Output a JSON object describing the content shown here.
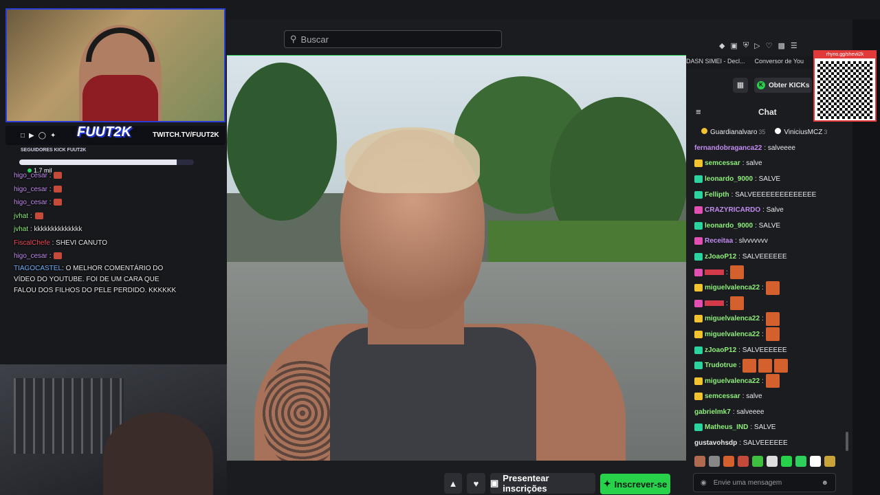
{
  "search": {
    "placeholder": "Buscar"
  },
  "bookmarks": [
    "DASN SIMEI - Decl...",
    "Conversor de You"
  ],
  "stream_overlay": {
    "brand": "FUUT2K",
    "twitch_url": "TWITCH.TV/FUUT2K",
    "followers_label": "SEGUIDORES KICK FUUT2K",
    "followers_count": "1.7 mil",
    "followers_progress": 0.9
  },
  "left_chat": [
    {
      "user": "higo_cesar",
      "text": ":",
      "color": "purple",
      "emote": true
    },
    {
      "user": "higo_cesar",
      "text": ":",
      "color": "purple",
      "emote": true
    },
    {
      "user": "higo_cesar",
      "text": ":",
      "color": "purple",
      "emote": true
    },
    {
      "user": "jvhat",
      "text": ":",
      "color": "green",
      "emote": true
    },
    {
      "user": "jvhat",
      "text": ": kkkkkkkkkkkkkk",
      "color": "green",
      "emote": false
    },
    {
      "user": "FiscalChefe",
      "text": ": SHEVI CANUTO",
      "color": "red",
      "emote": false
    },
    {
      "user": "higo_cesar",
      "text": ":",
      "color": "purple",
      "emote": true
    }
  ],
  "left_chat_long": {
    "user": "TIAGOCASTEL",
    "text": ": O MELHOR COMENTÁRIO DO VÍDEO DO YOUTUBE. FOI DE UM CARA QUE FALOU DOS FILHOS DO PELE PERDIDO. KKKKKK"
  },
  "player_buttons": {
    "gift": "Presentear inscrições",
    "subscribe": "Inscrever-se"
  },
  "chat": {
    "title": "Chat",
    "kicks_label": "Obter KICKs",
    "pinned": [
      {
        "user": "Guardianalvaro",
        "count": "35"
      },
      {
        "user": "ViniciusMCZ",
        "count": "3"
      }
    ],
    "input_placeholder": "Envie uma mensagem",
    "messages": [
      {
        "user": "fernandobraganca22",
        "text": ": salveeee",
        "color": "#c28cf0",
        "badge": "",
        "sticker": 0
      },
      {
        "user": "semcessar",
        "text": ": salve",
        "color": "#8ef07a",
        "badge": "yellow",
        "sticker": 0
      },
      {
        "user": "leonardo_9000",
        "text": ": SALVE",
        "color": "#8ef07a",
        "badge": "teal",
        "sticker": 0
      },
      {
        "user": "Fellipth",
        "text": ": SALVEEEEEEEEEEEEEE",
        "color": "#8ef07a",
        "badge": "teal",
        "sticker": 0
      },
      {
        "user": "CRAZYRICARDO",
        "text": ": Salve",
        "color": "#c28cf0",
        "badge": "pink",
        "sticker": 0
      },
      {
        "user": "leonardo_9000",
        "text": ": SALVE",
        "color": "#8ef07a",
        "badge": "teal",
        "sticker": 0
      },
      {
        "user": "Receitaa",
        "text": ": slvvvvvvv",
        "color": "#c28cf0",
        "badge": "pink",
        "sticker": 0
      },
      {
        "user": "zJoaoP12",
        "text": ": SALVEEEEEE",
        "color": "#8ef07a",
        "badge": "teal",
        "sticker": 0
      },
      {
        "user": "",
        "text": ":",
        "color": "#f14b5a",
        "badge": "pink",
        "sticker": 1
      },
      {
        "user": "miguelvalenca22",
        "text": ":",
        "color": "#8ef07a",
        "badge": "yellow",
        "sticker": 1
      },
      {
        "user": "",
        "text": ":",
        "color": "#f14b5a",
        "badge": "pink",
        "sticker": 1
      },
      {
        "user": "miguelvalenca22",
        "text": ":",
        "color": "#8ef07a",
        "badge": "yellow",
        "sticker": 1
      },
      {
        "user": "miguelvalenca22",
        "text": ":",
        "color": "#8ef07a",
        "badge": "yellow",
        "sticker": 1
      },
      {
        "user": "zJoaoP12",
        "text": ": SALVEEEEEE",
        "color": "#8ef07a",
        "badge": "teal",
        "sticker": 0
      },
      {
        "user": "Trudotrue",
        "text": ":",
        "color": "#8ef07a",
        "badge": "teal",
        "sticker": 3
      },
      {
        "user": "miguelvalenca22",
        "text": ":",
        "color": "#8ef07a",
        "badge": "yellow",
        "sticker": 1
      },
      {
        "user": "semcessar",
        "text": ": salve",
        "color": "#8ef07a",
        "badge": "yellow",
        "sticker": 0
      },
      {
        "user": "gabrielmk7",
        "text": ": salveeee",
        "color": "#8ef07a",
        "badge": "",
        "sticker": 0
      },
      {
        "user": "Matheus_IND",
        "text": ": SALVE",
        "color": "#8ef07a",
        "badge": "teal",
        "sticker": 0
      },
      {
        "user": "gustavohsdp",
        "text": ": SALVEEEEEE",
        "color": "#e8e8ea",
        "badge": "",
        "sticker": 0
      }
    ]
  },
  "qr_label": "rhyno.gg/shevii2k",
  "colors": {
    "accent_green": "#27d14a",
    "overlay_blue": "#2a3cd8"
  }
}
